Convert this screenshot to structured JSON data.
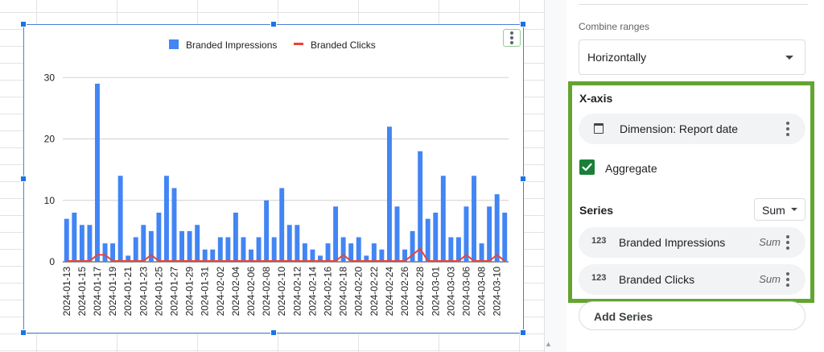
{
  "chart_data": {
    "type": "bar",
    "categories": [
      "2024-01-13",
      "2024-01-14",
      "2024-01-15",
      "2024-01-16",
      "2024-01-17",
      "2024-01-18",
      "2024-01-19",
      "2024-01-20",
      "2024-01-21",
      "2024-01-22",
      "2024-01-23",
      "2024-01-24",
      "2024-01-25",
      "2024-01-26",
      "2024-01-27",
      "2024-01-28",
      "2024-01-29",
      "2024-01-30",
      "2024-01-31",
      "2024-02-01",
      "2024-02-02",
      "2024-02-03",
      "2024-02-04",
      "2024-02-05",
      "2024-02-06",
      "2024-02-07",
      "2024-02-08",
      "2024-02-09",
      "2024-02-10",
      "2024-02-11",
      "2024-02-12",
      "2024-02-13",
      "2024-02-14",
      "2024-02-15",
      "2024-02-16",
      "2024-02-17",
      "2024-02-18",
      "2024-02-19",
      "2024-02-20",
      "2024-02-21",
      "2024-02-22",
      "2024-02-23",
      "2024-02-24",
      "2024-02-25",
      "2024-02-26",
      "2024-02-27",
      "2024-02-28",
      "2024-02-29",
      "2024-03-01",
      "2024-03-02",
      "2024-03-03",
      "2024-03-04",
      "2024-03-06",
      "2024-03-07",
      "2024-03-08",
      "2024-03-09",
      "2024-03-10",
      "2024-03-11"
    ],
    "tick_labels": [
      "2024-01-13",
      "2024-01-15",
      "2024-01-17",
      "2024-01-19",
      "2024-01-21",
      "2024-01-23",
      "2024-01-25",
      "2024-01-27",
      "2024-01-29",
      "2024-01-31",
      "2024-02-02",
      "2024-02-04",
      "2024-02-06",
      "2024-02-08",
      "2024-02-10",
      "2024-02-12",
      "2024-02-14",
      "2024-02-16",
      "2024-02-18",
      "2024-02-20",
      "2024-02-22",
      "2024-02-24",
      "2024-02-26",
      "2024-02-28",
      "2024-03-01",
      "2024-03-03",
      "2024-03-06",
      "2024-03-08",
      "2024-03-10"
    ],
    "series": [
      {
        "name": "Branded Impressions",
        "type": "bar",
        "color": "#4285f4",
        "values": [
          7,
          8,
          6,
          6,
          29,
          3,
          3,
          14,
          1,
          4,
          6,
          5,
          8,
          14,
          12,
          5,
          5,
          6,
          2,
          2,
          4,
          4,
          8,
          4,
          2,
          4,
          10,
          4,
          12,
          6,
          6,
          3,
          2,
          1,
          3,
          9,
          4,
          3,
          4,
          1,
          3,
          2,
          22,
          9,
          2,
          5,
          18,
          7,
          8,
          14,
          4,
          4,
          9,
          14,
          3,
          9,
          11,
          8
        ]
      },
      {
        "name": "Branded Clicks",
        "type": "line",
        "color": "#ea4335",
        "values": [
          0,
          0,
          0,
          0,
          1,
          1,
          0,
          0,
          0,
          0,
          0,
          1,
          0,
          0,
          0,
          0,
          0,
          0,
          0,
          0,
          0,
          0,
          0,
          0,
          0,
          0,
          0,
          0,
          0,
          0,
          0,
          0,
          0,
          0,
          0,
          0,
          1,
          0,
          0,
          0,
          0,
          0,
          0,
          0,
          0,
          1,
          2,
          0,
          0,
          0,
          0,
          0,
          1,
          0,
          0,
          0,
          1,
          0
        ]
      }
    ],
    "yticks": [
      0,
      10,
      20,
      30
    ],
    "ylim": [
      0,
      32
    ],
    "grid": true,
    "legend": "top-center"
  },
  "panel": {
    "combine_label": "Combine ranges",
    "combine_value": "Horizontally",
    "xaxis_title": "X-axis",
    "dimension_label": "Dimension: Report date",
    "aggregate_label": "Aggregate",
    "aggregate_checked": true,
    "series_title": "Series",
    "series_agg_value": "Sum",
    "series": [
      {
        "icon": "123",
        "label": "Branded Impressions",
        "agg": "Sum"
      },
      {
        "icon": "123",
        "label": "Branded Clicks",
        "agg": "Sum"
      }
    ],
    "add_series_label": "Add Series"
  },
  "colors": {
    "highlight": "#64a431",
    "accent": "#1a73e8",
    "checkbox": "#188038"
  }
}
